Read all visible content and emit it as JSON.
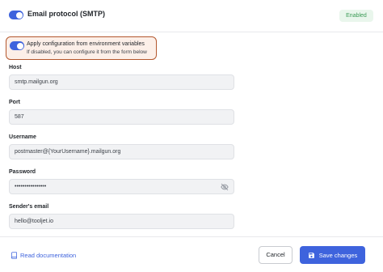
{
  "header": {
    "title": "Email protocol (SMTP)",
    "toggle_on": true,
    "status_badge": "Enabled",
    "status_color": "#3a9a55"
  },
  "env_config": {
    "toggle_on": true,
    "title": "Apply configuration from environment variables",
    "subtitle": "If disabled, you can configure it from the form below",
    "highlight_color": "#b4582e"
  },
  "fields": {
    "host": {
      "label": "Host",
      "value": "smtp.mailgun.org"
    },
    "port": {
      "label": "Port",
      "value": "587"
    },
    "username": {
      "label": "Username",
      "value": "postmaster@{YourUsername}.mailgun.org"
    },
    "password": {
      "label": "Password",
      "value": "••••••••••••••••",
      "icon": "eye-off-icon"
    },
    "sender_email": {
      "label": "Sender's email",
      "value": "hello@tooljet.io"
    }
  },
  "footer": {
    "doc_link": "Read documentation",
    "doc_icon": "book-icon",
    "cancel_label": "Cancel",
    "save_label": "Save changes",
    "save_icon": "floppy-disk-icon",
    "accent_color": "#3e63dd"
  }
}
